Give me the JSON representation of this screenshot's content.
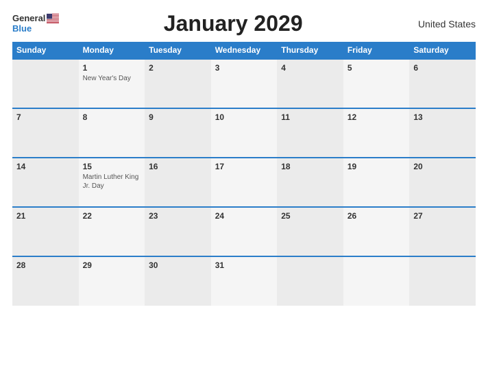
{
  "header": {
    "title": "January 2029",
    "country": "United States",
    "logo_general": "General",
    "logo_blue": "Blue"
  },
  "calendar": {
    "weekdays": [
      "Sunday",
      "Monday",
      "Tuesday",
      "Wednesday",
      "Thursday",
      "Friday",
      "Saturday"
    ],
    "weeks": [
      [
        {
          "day": "",
          "holiday": ""
        },
        {
          "day": "1",
          "holiday": "New Year's Day"
        },
        {
          "day": "2",
          "holiday": ""
        },
        {
          "day": "3",
          "holiday": ""
        },
        {
          "day": "4",
          "holiday": ""
        },
        {
          "day": "5",
          "holiday": ""
        },
        {
          "day": "6",
          "holiday": ""
        }
      ],
      [
        {
          "day": "7",
          "holiday": ""
        },
        {
          "day": "8",
          "holiday": ""
        },
        {
          "day": "9",
          "holiday": ""
        },
        {
          "day": "10",
          "holiday": ""
        },
        {
          "day": "11",
          "holiday": ""
        },
        {
          "day": "12",
          "holiday": ""
        },
        {
          "day": "13",
          "holiday": ""
        }
      ],
      [
        {
          "day": "14",
          "holiday": ""
        },
        {
          "day": "15",
          "holiday": "Martin Luther King Jr. Day"
        },
        {
          "day": "16",
          "holiday": ""
        },
        {
          "day": "17",
          "holiday": ""
        },
        {
          "day": "18",
          "holiday": ""
        },
        {
          "day": "19",
          "holiday": ""
        },
        {
          "day": "20",
          "holiday": ""
        }
      ],
      [
        {
          "day": "21",
          "holiday": ""
        },
        {
          "day": "22",
          "holiday": ""
        },
        {
          "day": "23",
          "holiday": ""
        },
        {
          "day": "24",
          "holiday": ""
        },
        {
          "day": "25",
          "holiday": ""
        },
        {
          "day": "26",
          "holiday": ""
        },
        {
          "day": "27",
          "holiday": ""
        }
      ],
      [
        {
          "day": "28",
          "holiday": ""
        },
        {
          "day": "29",
          "holiday": ""
        },
        {
          "day": "30",
          "holiday": ""
        },
        {
          "day": "31",
          "holiday": ""
        },
        {
          "day": "",
          "holiday": ""
        },
        {
          "day": "",
          "holiday": ""
        },
        {
          "day": "",
          "holiday": ""
        }
      ]
    ]
  }
}
